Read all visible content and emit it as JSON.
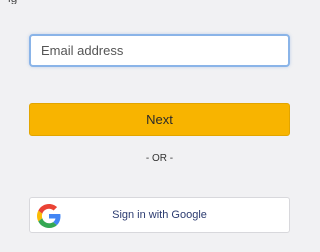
{
  "top_fragment": "ig",
  "form": {
    "email_placeholder": "Email address",
    "email_value": "",
    "next_label": "Next",
    "or_label": "- OR -",
    "google_label": "Sign in with Google"
  },
  "icons": {
    "google": "google-g-logo"
  },
  "colors": {
    "background": "#f1f1f3",
    "next_button": "#f8b400",
    "input_focus_border": "#8ab4e8",
    "google_label": "#2b3b70"
  }
}
